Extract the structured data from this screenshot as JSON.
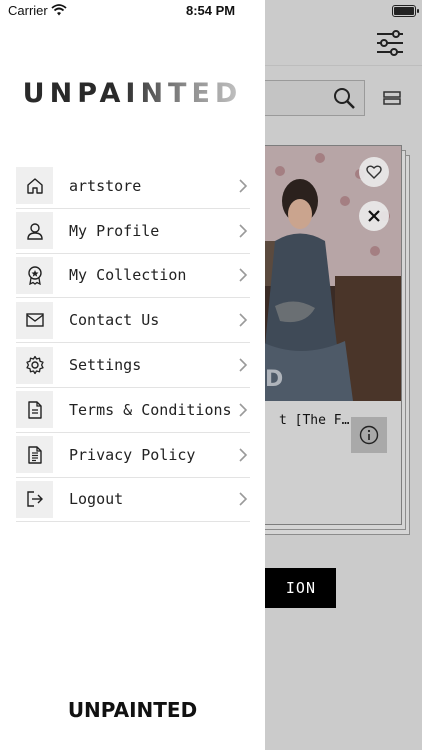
{
  "status_bar": {
    "carrier": "Carrier",
    "time": "8:54 PM"
  },
  "drawer": {
    "logo": "UNPAINTED",
    "footer_logo": "UNPAINTED",
    "menu": [
      {
        "label": "artstore",
        "icon": "home-icon"
      },
      {
        "label": "My Profile",
        "icon": "user-icon"
      },
      {
        "label": "My Collection",
        "icon": "award-icon"
      },
      {
        "label": "Contact Us",
        "icon": "mail-icon"
      },
      {
        "label": "Settings",
        "icon": "gear-icon"
      },
      {
        "label": "Terms & Conditions",
        "icon": "document-icon"
      },
      {
        "label": "Privacy Policy",
        "icon": "policy-icon"
      },
      {
        "label": "Logout",
        "icon": "logout-icon"
      }
    ]
  },
  "background": {
    "card_title": "t [The F…",
    "card_watermark": "D",
    "cta_label": "ION"
  }
}
